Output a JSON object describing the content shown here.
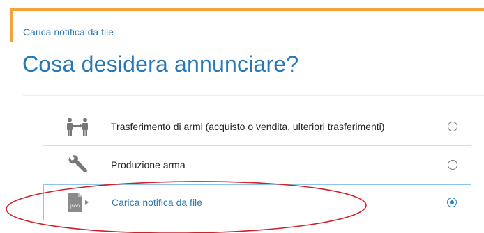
{
  "header": {
    "breadcrumb": "Carica notifica da file",
    "title": "Cosa desidera annunciare?"
  },
  "options": [
    {
      "label": "Trasferimento di armi (acquisto o vendita, ulteriori trasferimenti)",
      "icon": "people-transfer-icon",
      "selected": false
    },
    {
      "label": "Produzione arma",
      "icon": "wrench-icon",
      "selected": false
    },
    {
      "label": "Carica notifica da file",
      "icon": "json-file-icon",
      "icon_text": "json",
      "selected": true
    }
  ],
  "colors": {
    "accent": "#f5a33a",
    "primary": "#2878b8",
    "annotation": "#d0202a"
  }
}
